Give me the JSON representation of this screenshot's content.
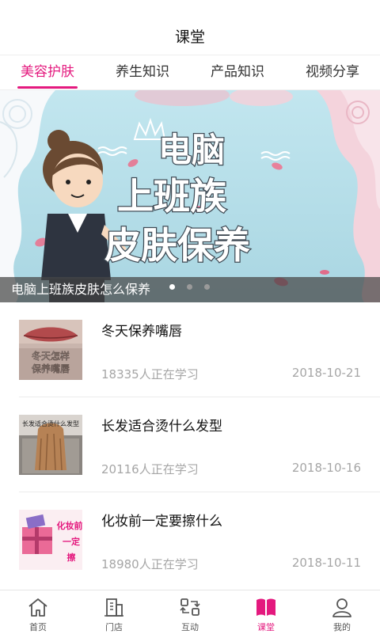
{
  "header": {
    "title": "课堂"
  },
  "tabs": [
    {
      "label": "美容护肤",
      "active": true
    },
    {
      "label": "养生知识",
      "active": false
    },
    {
      "label": "产品知识",
      "active": false
    },
    {
      "label": "视频分享",
      "active": false
    }
  ],
  "banner": {
    "headline_lines": [
      "电脑",
      "上班族",
      "皮肤保养"
    ],
    "caption": "电脑上班族皮肤怎么保养",
    "slide_count": 3,
    "active_slide": 1
  },
  "courses": [
    {
      "title": "冬天保养嘴唇",
      "thumb_text": [
        "冬天怎样",
        "保养嘴唇"
      ],
      "learners": "18335人正在学习",
      "date": "2018-10-21"
    },
    {
      "title": "长发适合烫什么发型",
      "thumb_text": [
        "长发适合烫什么发型"
      ],
      "learners": "20116人正在学习",
      "date": "2018-10-16"
    },
    {
      "title": "化妆前一定要擦什么",
      "thumb_text": [
        "化妆前",
        "一定",
        "擦"
      ],
      "learners": "18980人正在学习",
      "date": "2018-10-11"
    }
  ],
  "tabbar": [
    {
      "label": "首页",
      "icon": "home-icon",
      "active": false
    },
    {
      "label": "门店",
      "icon": "store-icon",
      "active": false
    },
    {
      "label": "互动",
      "icon": "interact-icon",
      "active": false
    },
    {
      "label": "课堂",
      "icon": "book-icon",
      "active": true
    },
    {
      "label": "我的",
      "icon": "user-icon",
      "active": false
    }
  ],
  "colors": {
    "accent": "#e4197e",
    "banner_bg": "#b6dfe9",
    "muted_text": "#a6a6a6"
  }
}
